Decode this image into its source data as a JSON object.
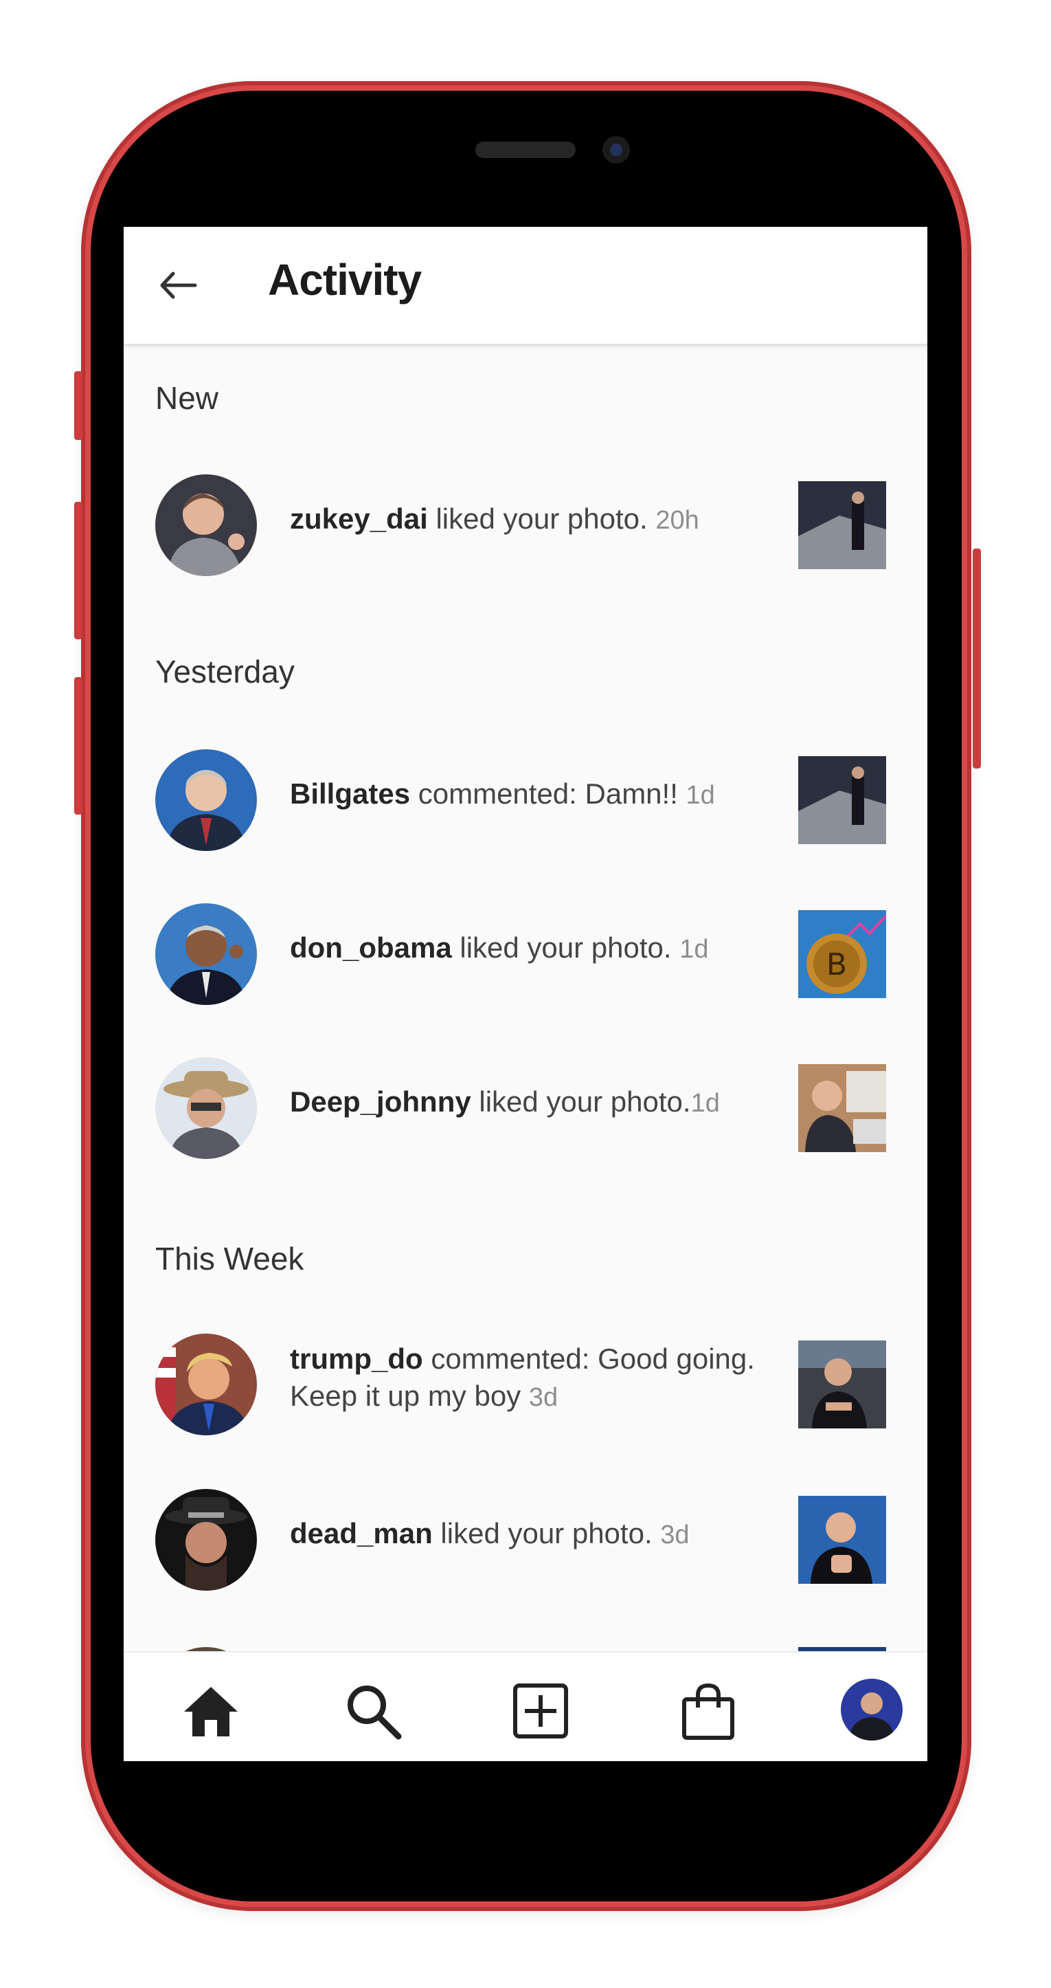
{
  "header": {
    "title": "Activity"
  },
  "sections": {
    "new": "New",
    "yesterday": "Yesterday",
    "this_week": "This Week"
  },
  "notifications": [
    {
      "user": "zukey_dai",
      "text": " liked your photo. ",
      "time": "20h"
    },
    {
      "user": "Billgates",
      "text": " commented: Damn!! ",
      "time": "1d"
    },
    {
      "user": "don_obama",
      "text": " liked your photo. ",
      "time": "1d"
    },
    {
      "user": "Deep_johnny",
      "text": " liked your photo.",
      "time": "1d"
    },
    {
      "user": "trump_do",
      "text": " commented: Good going. Keep it up my boy ",
      "time": "3d"
    },
    {
      "user": "dead_man",
      "text": " liked your photo. ",
      "time": "3d"
    }
  ],
  "nav": {
    "icons": [
      "home-icon",
      "search-icon",
      "add-post-icon",
      "shop-icon",
      "profile-avatar"
    ]
  },
  "colors": {
    "phone_frame": "#d84848",
    "screen_bg": "#fafafa",
    "username": "#262626",
    "timestamp": "#8d8d8d"
  }
}
